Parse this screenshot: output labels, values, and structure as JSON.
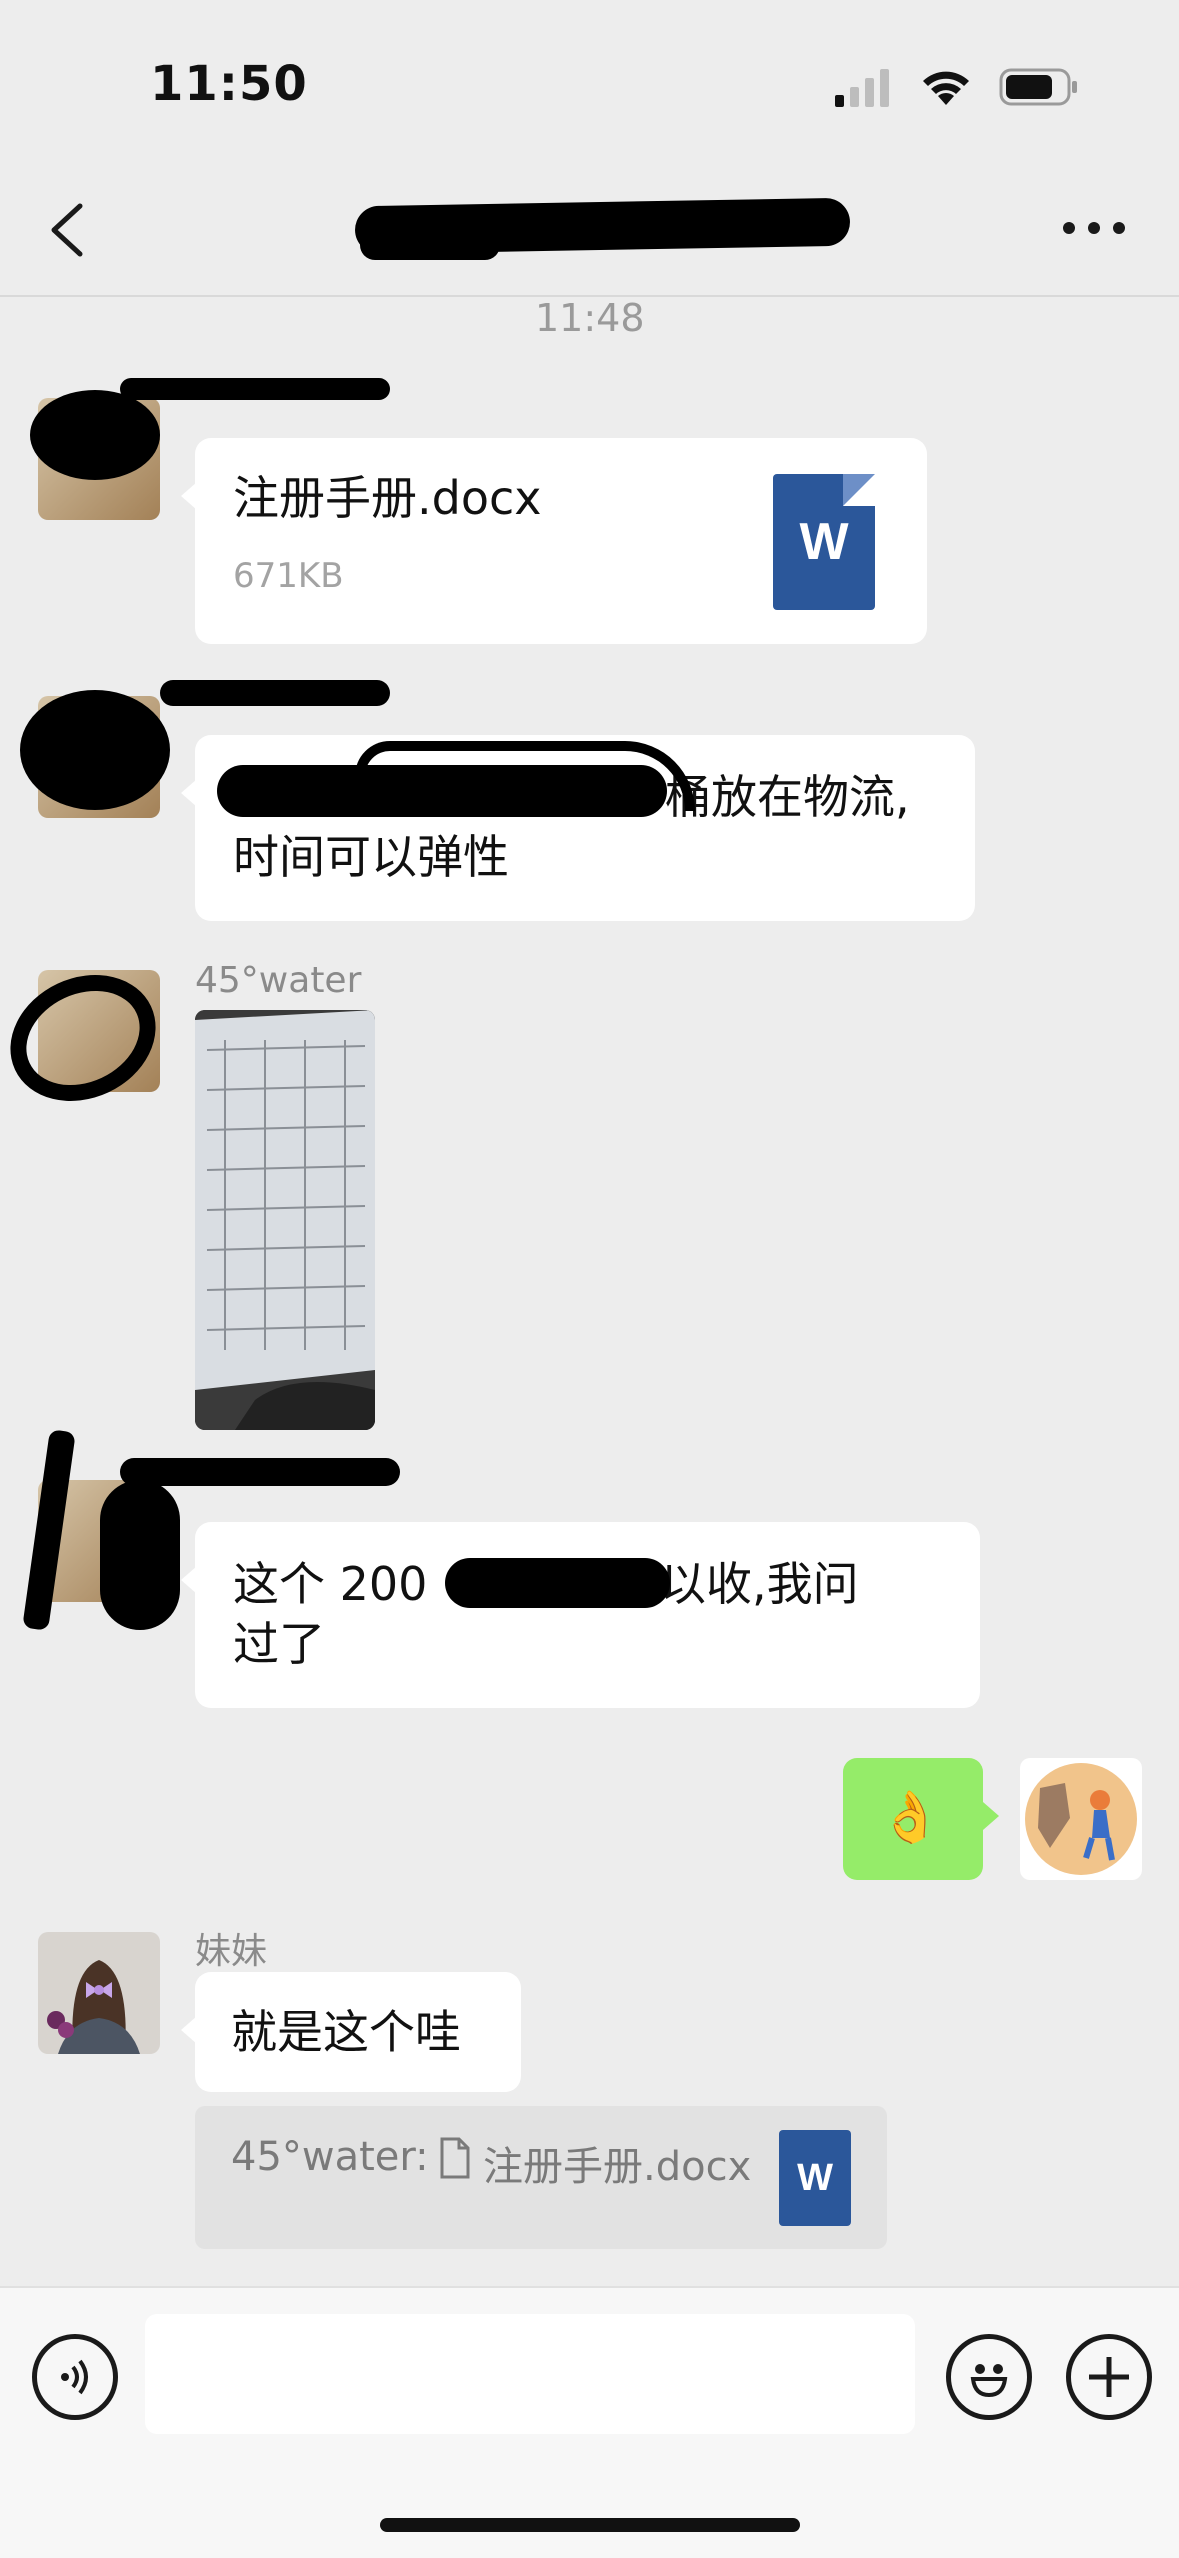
{
  "status_bar": {
    "time": "11:50"
  },
  "header": {
    "title": ""
  },
  "chat": {
    "timestamp": "11:48",
    "messages": [
      {
        "file_name": "注册手册.docx",
        "file_size": "671KB",
        "file_badge": "W"
      },
      {
        "text_line1": "桶放在物流,",
        "text_line2": "时间可以弹性"
      },
      {
        "sender": "45°water"
      },
      {
        "text_line1_a": "这个 200 ",
        "text_line1_b": "以收,我问",
        "text_line2": "过了"
      },
      {
        "text": "👌"
      },
      {
        "sender": "妹妹",
        "text": "就是这个哇",
        "quote": {
          "label": "45°water:",
          "file_name": "注册手册.docx",
          "badge": "W"
        }
      }
    ]
  }
}
